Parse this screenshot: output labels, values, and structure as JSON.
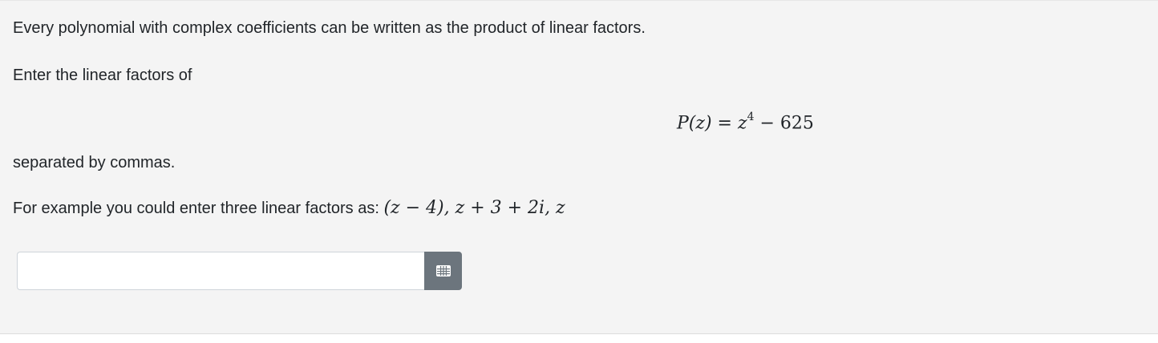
{
  "question": {
    "line1": "Every polynomial with complex coefficients can be written as the product of linear factors.",
    "line2": "Enter the linear factors of",
    "equation": {
      "lhs": "P(z) = z",
      "exponent": "4",
      "rhs": " − 625"
    },
    "line3": "separated by commas.",
    "example_intro": "For example you could enter three linear factors as: ",
    "example_math": "(z − 4), z + 3 + 2i, z"
  },
  "answer": {
    "value": "",
    "placeholder": ""
  },
  "icons": {
    "matrix_button": "grid-icon"
  }
}
